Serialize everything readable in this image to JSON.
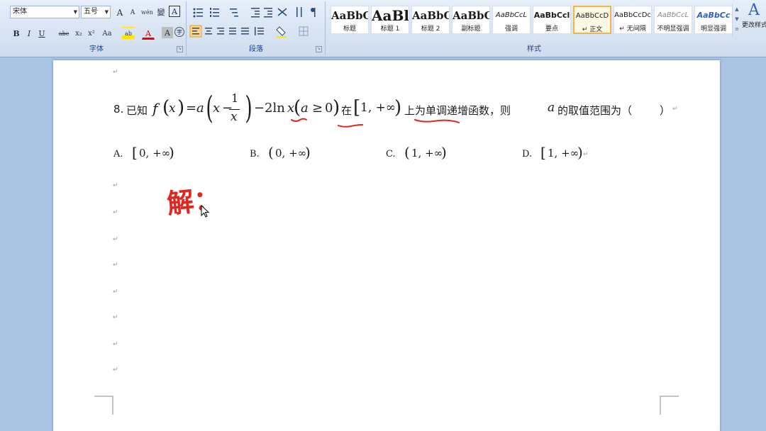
{
  "ribbon": {
    "font_group": {
      "label": "字体",
      "font_name": "宋体",
      "font_size": "五号",
      "grow_label": "A",
      "shrink_label": "A",
      "phonetic_label": "wén",
      "clear_label": "變",
      "border_label": "A",
      "bold_label": "B",
      "italic_label": "I",
      "underline_label": "U",
      "strike_label": "abc",
      "subscript_label": "x₂",
      "superscript_label": "x²",
      "case_label": "Aa",
      "highlight_label": "ab",
      "color_label": "A",
      "shade_label": "A",
      "enclose_label": "字"
    },
    "paragraph_group": {
      "label": "段落"
    },
    "styles_group": {
      "label": "样式",
      "items": [
        {
          "sample": "AaBbC",
          "name": "标题"
        },
        {
          "sample": "AaBl",
          "name": "标题 1"
        },
        {
          "sample": "AaBbC",
          "name": "标题 2"
        },
        {
          "sample": "AaBbC",
          "name": "副标题"
        },
        {
          "sample": "AaBbCcL",
          "name": "强调"
        },
        {
          "sample": "AaBbCcl",
          "name": "要点"
        },
        {
          "sample": "AaBbCcD",
          "name": "↵ 正文"
        },
        {
          "sample": "AaBbCcDc",
          "name": "↵ 无间隔"
        },
        {
          "sample": "AaBbCcL",
          "name": "不明显强调"
        },
        {
          "sample": "AaBbCc",
          "name": "明显强调"
        }
      ]
    },
    "change_styles_label": "更改样式",
    "change_styles_icon": "A"
  },
  "document": {
    "paragraph_mark": "↵",
    "question": {
      "number": "8.",
      "lead": "已知",
      "f": "f",
      "x": "x",
      "a": "a",
      "eq": "=",
      "minus": "−",
      "one": "1",
      "two_ln": "2ln",
      "geq": "≥",
      "zero": "0",
      "zai": "在",
      "interval": "1, +∞",
      "after": "上为单调递增函数，则",
      "tail": "的取值范围为（",
      "close": "）"
    },
    "options": [
      {
        "label": "A.",
        "left": "[",
        "body": "0, +∞",
        "right": ")"
      },
      {
        "label": "B.",
        "left": "(",
        "body": "0, +∞",
        "right": ")"
      },
      {
        "label": "C.",
        "left": "(",
        "body": "1, +∞",
        "right": ")"
      },
      {
        "label": "D.",
        "left": "[",
        "body": "1, +∞",
        "right": ")"
      }
    ],
    "handwriting": "解："
  },
  "colors": {
    "annotation": "#e0261f",
    "ribbon_text": "#15428b"
  }
}
